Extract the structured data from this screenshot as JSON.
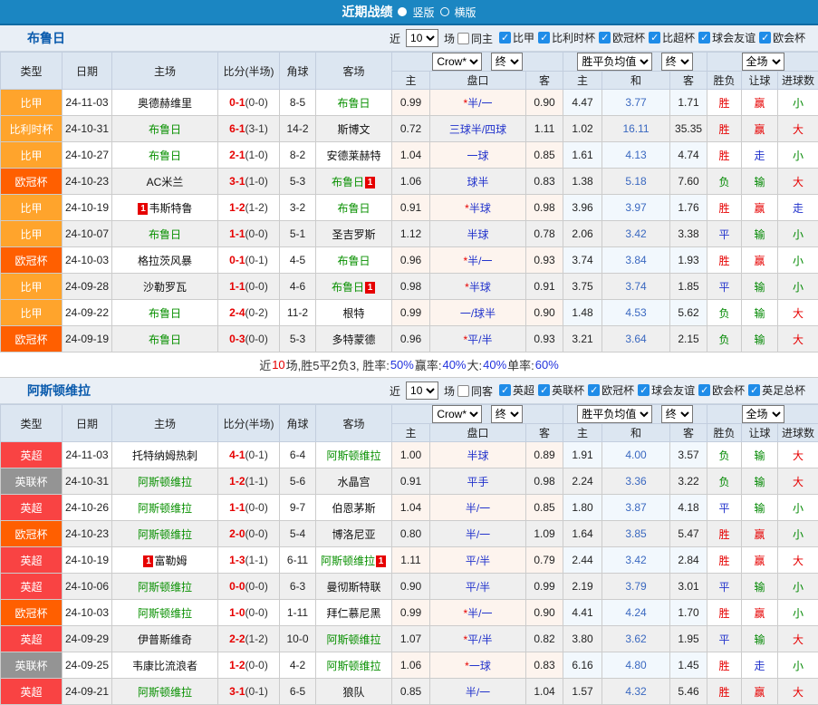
{
  "topbar": {
    "title": "近期战绩",
    "options": [
      {
        "label": "竖版",
        "selected": true
      },
      {
        "label": "横版",
        "selected": false
      }
    ]
  },
  "filter": {
    "near_label": "近",
    "count": "10",
    "games_label": "场"
  },
  "table_header": {
    "cols": [
      "类型",
      "日期",
      "主场",
      "比分(半场)",
      "角球",
      "客场"
    ],
    "odds_company_select": "Crow*",
    "stage_select": "终",
    "avg_select": "胜平负均值",
    "scope_select": "全场",
    "odds_sub": [
      "主",
      "盘口",
      "客"
    ],
    "avg_sub": [
      "主",
      "和",
      "客"
    ],
    "result_sub": [
      "胜负",
      "让球",
      "进球数"
    ]
  },
  "league_colors": {
    "比甲": "#ffa42c",
    "比利时杯": "#ffa42c",
    "欧冠杯": "#ff5f00",
    "英超": "#f94343",
    "英联杯": "#949494"
  },
  "result_colors": {
    "胜": "#e60000",
    "平": "#2233cc",
    "负": "#008800",
    "赢": "#e60000",
    "输": "#008800",
    "走": "#2233cc",
    "大": "#e60000",
    "小": "#008800"
  },
  "sections": [
    {
      "team": "布鲁日",
      "same_label": "同主",
      "leagues": [
        "比甲",
        "比利时杯",
        "欧冠杯",
        "比超杯",
        "球会友谊",
        "欧会杯"
      ],
      "rows": [
        {
          "league": "比甲",
          "date": "24-11-03",
          "home": "奥德赫维里",
          "home_card": "",
          "home_is_subject": false,
          "score": "0-1",
          "half": "(0-0)",
          "corners": "8-5",
          "away": "布鲁日",
          "away_card": "",
          "away_is_subject": true,
          "crow_home": "0.99",
          "handicap": "半/一",
          "handicap_star": true,
          "crow_away": "0.90",
          "avg_home": "4.47",
          "avg_draw": "3.77",
          "avg_away": "1.71",
          "outcome": "胜",
          "handicap_outcome": "赢",
          "goals_outcome": "小"
        },
        {
          "league": "比利时杯",
          "date": "24-10-31",
          "home": "布鲁日",
          "home_card": "",
          "home_is_subject": true,
          "score": "6-1",
          "half": "(3-1)",
          "corners": "14-2",
          "away": "斯博文",
          "away_card": "",
          "away_is_subject": false,
          "crow_home": "0.72",
          "handicap": "三球半/四球",
          "handicap_star": false,
          "crow_away": "1.11",
          "avg_home": "1.02",
          "avg_draw": "16.11",
          "avg_away": "35.35",
          "outcome": "胜",
          "handicap_outcome": "赢",
          "goals_outcome": "大"
        },
        {
          "league": "比甲",
          "date": "24-10-27",
          "home": "布鲁日",
          "home_card": "",
          "home_is_subject": true,
          "score": "2-1",
          "half": "(1-0)",
          "corners": "8-2",
          "away": "安德莱赫特",
          "away_card": "",
          "away_is_subject": false,
          "crow_home": "1.04",
          "handicap": "一球",
          "handicap_star": false,
          "crow_away": "0.85",
          "avg_home": "1.61",
          "avg_draw": "4.13",
          "avg_away": "4.74",
          "outcome": "胜",
          "handicap_outcome": "走",
          "goals_outcome": "小"
        },
        {
          "league": "欧冠杯",
          "date": "24-10-23",
          "home": "AC米兰",
          "home_card": "",
          "home_is_subject": false,
          "score": "3-1",
          "half": "(1-0)",
          "corners": "5-3",
          "away": "布鲁日",
          "away_card": "1",
          "away_is_subject": true,
          "crow_home": "1.06",
          "handicap": "球半",
          "handicap_star": false,
          "crow_away": "0.83",
          "avg_home": "1.38",
          "avg_draw": "5.18",
          "avg_away": "7.60",
          "outcome": "负",
          "handicap_outcome": "输",
          "goals_outcome": "大"
        },
        {
          "league": "比甲",
          "date": "24-10-19",
          "home": "韦斯特鲁",
          "home_card": "1",
          "home_is_subject": false,
          "score": "1-2",
          "half": "(1-2)",
          "corners": "3-2",
          "away": "布鲁日",
          "away_card": "",
          "away_is_subject": true,
          "crow_home": "0.91",
          "handicap": "半球",
          "handicap_star": true,
          "crow_away": "0.98",
          "avg_home": "3.96",
          "avg_draw": "3.97",
          "avg_away": "1.76",
          "outcome": "胜",
          "handicap_outcome": "赢",
          "goals_outcome": "走"
        },
        {
          "league": "比甲",
          "date": "24-10-07",
          "home": "布鲁日",
          "home_card": "",
          "home_is_subject": true,
          "score": "1-1",
          "half": "(0-0)",
          "corners": "5-1",
          "away": "圣吉罗斯",
          "away_card": "",
          "away_is_subject": false,
          "crow_home": "1.12",
          "handicap": "半球",
          "handicap_star": false,
          "crow_away": "0.78",
          "avg_home": "2.06",
          "avg_draw": "3.42",
          "avg_away": "3.38",
          "outcome": "平",
          "handicap_outcome": "输",
          "goals_outcome": "小"
        },
        {
          "league": "欧冠杯",
          "date": "24-10-03",
          "home": "格拉茨风暴",
          "home_card": "",
          "home_is_subject": false,
          "score": "0-1",
          "half": "(0-1)",
          "corners": "4-5",
          "away": "布鲁日",
          "away_card": "",
          "away_is_subject": true,
          "crow_home": "0.96",
          "handicap": "半/一",
          "handicap_star": true,
          "crow_away": "0.93",
          "avg_home": "3.74",
          "avg_draw": "3.84",
          "avg_away": "1.93",
          "outcome": "胜",
          "handicap_outcome": "赢",
          "goals_outcome": "小"
        },
        {
          "league": "比甲",
          "date": "24-09-28",
          "home": "沙勒罗瓦",
          "home_card": "",
          "home_is_subject": false,
          "score": "1-1",
          "half": "(0-0)",
          "corners": "4-6",
          "away": "布鲁日",
          "away_card": "1",
          "away_is_subject": true,
          "crow_home": "0.98",
          "handicap": "半球",
          "handicap_star": true,
          "crow_away": "0.91",
          "avg_home": "3.75",
          "avg_draw": "3.74",
          "avg_away": "1.85",
          "outcome": "平",
          "handicap_outcome": "输",
          "goals_outcome": "小"
        },
        {
          "league": "比甲",
          "date": "24-09-22",
          "home": "布鲁日",
          "home_card": "",
          "home_is_subject": true,
          "score": "2-4",
          "half": "(0-2)",
          "corners": "11-2",
          "away": "根特",
          "away_card": "",
          "away_is_subject": false,
          "crow_home": "0.99",
          "handicap": "一/球半",
          "handicap_star": false,
          "crow_away": "0.90",
          "avg_home": "1.48",
          "avg_draw": "4.53",
          "avg_away": "5.62",
          "outcome": "负",
          "handicap_outcome": "输",
          "goals_outcome": "大"
        },
        {
          "league": "欧冠杯",
          "date": "24-09-19",
          "home": "布鲁日",
          "home_card": "",
          "home_is_subject": true,
          "score": "0-3",
          "half": "(0-0)",
          "corners": "5-3",
          "away": "多特蒙德",
          "away_card": "",
          "away_is_subject": false,
          "crow_home": "0.96",
          "handicap": "平/半",
          "handicap_star": true,
          "crow_away": "0.93",
          "avg_home": "3.21",
          "avg_draw": "3.64",
          "avg_away": "2.15",
          "outcome": "负",
          "handicap_outcome": "输",
          "goals_outcome": "大"
        }
      ],
      "summary": {
        "near": "近",
        "count": "10",
        "seg1": "场,胜5平2负3, 胜率:",
        "win_rate": "50%",
        "seg2": " 赢率:",
        "handicap_rate": "40%",
        "seg3": " 大:",
        "big_rate": "40%",
        "seg4": " 单率:",
        "single_rate": "60%"
      }
    },
    {
      "team": "阿斯顿维拉",
      "same_label": "同客",
      "leagues": [
        "英超",
        "英联杯",
        "欧冠杯",
        "球会友谊",
        "欧会杯",
        "英足总杯"
      ],
      "rows": [
        {
          "league": "英超",
          "date": "24-11-03",
          "home": "托特纳姆热刺",
          "home_card": "",
          "home_is_subject": false,
          "score": "4-1",
          "half": "(0-1)",
          "corners": "6-4",
          "away": "阿斯顿维拉",
          "away_card": "",
          "away_is_subject": true,
          "crow_home": "1.00",
          "handicap": "半球",
          "handicap_star": false,
          "crow_away": "0.89",
          "avg_home": "1.91",
          "avg_draw": "4.00",
          "avg_away": "3.57",
          "outcome": "负",
          "handicap_outcome": "输",
          "goals_outcome": "大"
        },
        {
          "league": "英联杯",
          "date": "24-10-31",
          "home": "阿斯顿维拉",
          "home_card": "",
          "home_is_subject": true,
          "score": "1-2",
          "half": "(1-1)",
          "corners": "5-6",
          "away": "水晶宫",
          "away_card": "",
          "away_is_subject": false,
          "crow_home": "0.91",
          "handicap": "平手",
          "handicap_star": false,
          "crow_away": "0.98",
          "avg_home": "2.24",
          "avg_draw": "3.36",
          "avg_away": "3.22",
          "outcome": "负",
          "handicap_outcome": "输",
          "goals_outcome": "大"
        },
        {
          "league": "英超",
          "date": "24-10-26",
          "home": "阿斯顿维拉",
          "home_card": "",
          "home_is_subject": true,
          "score": "1-1",
          "half": "(0-0)",
          "corners": "9-7",
          "away": "伯恩茅斯",
          "away_card": "",
          "away_is_subject": false,
          "crow_home": "1.04",
          "handicap": "半/一",
          "handicap_star": false,
          "crow_away": "0.85",
          "avg_home": "1.80",
          "avg_draw": "3.87",
          "avg_away": "4.18",
          "outcome": "平",
          "handicap_outcome": "输",
          "goals_outcome": "小"
        },
        {
          "league": "欧冠杯",
          "date": "24-10-23",
          "home": "阿斯顿维拉",
          "home_card": "",
          "home_is_subject": true,
          "score": "2-0",
          "half": "(0-0)",
          "corners": "5-4",
          "away": "博洛尼亚",
          "away_card": "",
          "away_is_subject": false,
          "crow_home": "0.80",
          "handicap": "半/一",
          "handicap_star": false,
          "crow_away": "1.09",
          "avg_home": "1.64",
          "avg_draw": "3.85",
          "avg_away": "5.47",
          "outcome": "胜",
          "handicap_outcome": "赢",
          "goals_outcome": "小"
        },
        {
          "league": "英超",
          "date": "24-10-19",
          "home": "富勒姆",
          "home_card": "1",
          "home_is_subject": false,
          "score": "1-3",
          "half": "(1-1)",
          "corners": "6-11",
          "away": "阿斯顿维拉",
          "away_card": "1",
          "away_is_subject": true,
          "crow_home": "1.11",
          "handicap": "平/半",
          "handicap_star": false,
          "crow_away": "0.79",
          "avg_home": "2.44",
          "avg_draw": "3.42",
          "avg_away": "2.84",
          "outcome": "胜",
          "handicap_outcome": "赢",
          "goals_outcome": "大"
        },
        {
          "league": "英超",
          "date": "24-10-06",
          "home": "阿斯顿维拉",
          "home_card": "",
          "home_is_subject": true,
          "score": "0-0",
          "half": "(0-0)",
          "corners": "6-3",
          "away": "曼彻斯特联",
          "away_card": "",
          "away_is_subject": false,
          "crow_home": "0.90",
          "handicap": "平/半",
          "handicap_star": false,
          "crow_away": "0.99",
          "avg_home": "2.19",
          "avg_draw": "3.79",
          "avg_away": "3.01",
          "outcome": "平",
          "handicap_outcome": "输",
          "goals_outcome": "小"
        },
        {
          "league": "欧冠杯",
          "date": "24-10-03",
          "home": "阿斯顿维拉",
          "home_card": "",
          "home_is_subject": true,
          "score": "1-0",
          "half": "(0-0)",
          "corners": "1-11",
          "away": "拜仁慕尼黑",
          "away_card": "",
          "away_is_subject": false,
          "crow_home": "0.99",
          "handicap": "半/一",
          "handicap_star": true,
          "crow_away": "0.90",
          "avg_home": "4.41",
          "avg_draw": "4.24",
          "avg_away": "1.70",
          "outcome": "胜",
          "handicap_outcome": "赢",
          "goals_outcome": "小"
        },
        {
          "league": "英超",
          "date": "24-09-29",
          "home": "伊普斯维奇",
          "home_card": "",
          "home_is_subject": false,
          "score": "2-2",
          "half": "(1-2)",
          "corners": "10-0",
          "away": "阿斯顿维拉",
          "away_card": "",
          "away_is_subject": true,
          "crow_home": "1.07",
          "handicap": "平/半",
          "handicap_star": true,
          "crow_away": "0.82",
          "avg_home": "3.80",
          "avg_draw": "3.62",
          "avg_away": "1.95",
          "outcome": "平",
          "handicap_outcome": "输",
          "goals_outcome": "大"
        },
        {
          "league": "英联杯",
          "date": "24-09-25",
          "home": "韦康比流浪者",
          "home_card": "",
          "home_is_subject": false,
          "score": "1-2",
          "half": "(0-0)",
          "corners": "4-2",
          "away": "阿斯顿维拉",
          "away_card": "",
          "away_is_subject": true,
          "crow_home": "1.06",
          "handicap": "一球",
          "handicap_star": true,
          "crow_away": "0.83",
          "avg_home": "6.16",
          "avg_draw": "4.80",
          "avg_away": "1.45",
          "outcome": "胜",
          "handicap_outcome": "走",
          "goals_outcome": "小"
        },
        {
          "league": "英超",
          "date": "24-09-21",
          "home": "阿斯顿维拉",
          "home_card": "",
          "home_is_subject": true,
          "score": "3-1",
          "half": "(0-1)",
          "corners": "6-5",
          "away": "狼队",
          "away_card": "",
          "away_is_subject": false,
          "crow_home": "0.85",
          "handicap": "半/一",
          "handicap_star": false,
          "crow_away": "1.04",
          "avg_home": "1.57",
          "avg_draw": "4.32",
          "avg_away": "5.46",
          "outcome": "胜",
          "handicap_outcome": "赢",
          "goals_outcome": "大"
        }
      ],
      "summary": null
    }
  ]
}
